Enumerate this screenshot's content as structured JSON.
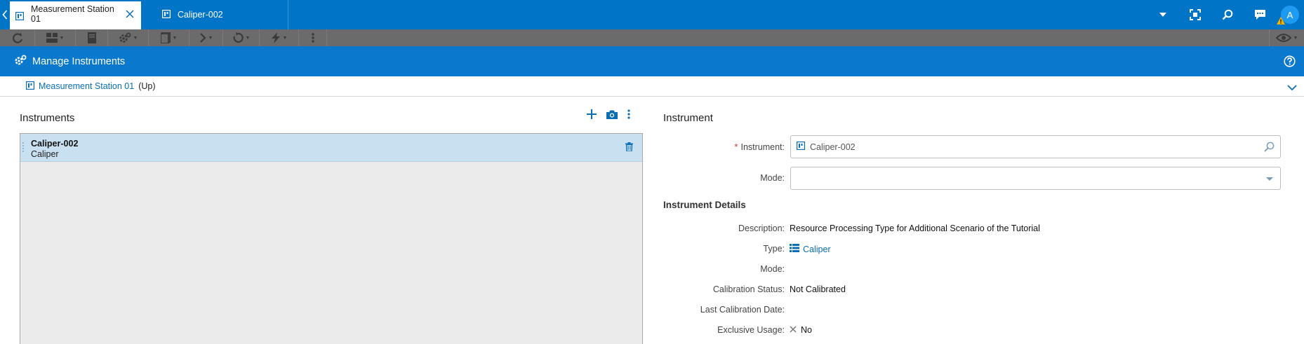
{
  "tabs": {
    "active": {
      "title": "Measurement Station 01"
    },
    "second": {
      "title": "Caliper-002"
    }
  },
  "user": {
    "avatar_initial": "A"
  },
  "header": {
    "title": "Manage Instruments"
  },
  "breadcrumb": {
    "link": "Measurement Station 01",
    "state": "(Up)"
  },
  "instruments_panel": {
    "title": "Instruments",
    "items": [
      {
        "name": "Caliper-002",
        "type": "Caliper"
      }
    ]
  },
  "instrument_panel": {
    "title": "Instrument",
    "instrument_label": "Instrument:",
    "instrument_value": "Caliper-002",
    "mode_label": "Mode:",
    "mode_value": "",
    "details_title": "Instrument Details",
    "details": {
      "description_label": "Description:",
      "description_value": "Resource Processing Type for Additional Scenario of the Tutorial",
      "type_label": "Type:",
      "type_value": "Caliper",
      "mode_label": "Mode:",
      "mode_value": "",
      "calibration_status_label": "Calibration Status:",
      "calibration_status_value": "Not Calibrated",
      "last_calibration_label": "Last Calibration Date:",
      "last_calibration_value": "",
      "exclusive_usage_label": "Exclusive Usage:",
      "exclusive_usage_value": "No"
    }
  },
  "colors": {
    "brand_blue": "#0075c8",
    "header_blue": "#0a78cc",
    "toolbar_gray": "#6b6b6b",
    "selection": "#c8e0f0",
    "link": "#0a6eb4"
  }
}
